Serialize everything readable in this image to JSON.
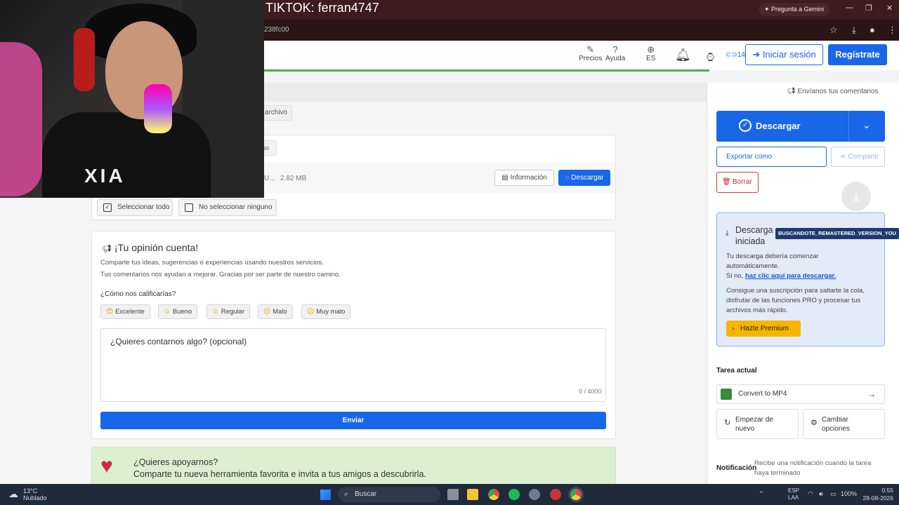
{
  "overlay": {
    "tiktok": "TIKTOK: ferran4747"
  },
  "browser": {
    "url_fragment": "238fc00",
    "gemini_button": "Pregunta a Gemini",
    "min": "—",
    "restore": "❐",
    "close": "✕"
  },
  "header": {
    "precios": "Precios",
    "ayuda": "Ayuda",
    "lang": "ES",
    "credits": "14",
    "login": "Iniciar sesión",
    "register": "Regístrate"
  },
  "subbar": {
    "feedback_link": "Envíanos tus comentarios"
  },
  "files": {
    "archivo_chip": "archivo",
    "no_chip": "no",
    "file_name_fragment": "U...",
    "file_size": "2.82 MB",
    "info_button": "Información",
    "download_button": "Descargar",
    "select_all": "Seleccionar todo",
    "select_none": "No seleccionar ninguno"
  },
  "feedback": {
    "title": "Tu opinión cuenta!",
    "title_prefix": "¡",
    "line1": "Comparte tus ideas, sugerencias o experiencias usando nuestros servicios.",
    "line2": "Tus comentarios nos ayudan a mejorar. Gracias por ser parte de nuestro camino.",
    "question": "¿Cómo nos calificarías?",
    "ratings": [
      "Excelente",
      "Bueno",
      "Regular",
      "Malo",
      "Muy malo"
    ],
    "textarea_placeholder": "¿Quieres contarnos algo? (opcional)",
    "counter": "0 / 4000",
    "send": "Enviar"
  },
  "support": {
    "title": "¿Quieres apoyarnos?",
    "text": "Comparte tu nueva herramienta favorita e invita a tus amigos a descubrirla."
  },
  "sidebar": {
    "download": "Descargar",
    "export": "Exportar como",
    "share": "Compartir",
    "delete": "Borrar",
    "dl_started_title": "Descarga iniciada",
    "tooltip": "BUSCANDOTE_REMASTERED_VERSION_YOU",
    "dl_line1": "Tu descarga debería comenzar",
    "dl_line2": "automáticamente.",
    "dl_line3_prefix": "Si no,",
    "dl_link": "haz clic aquí para descargar.",
    "promo1": "Consigue una suscripción para saltarte la cola,",
    "promo2": "disfrutar de las funciones PRO y procesar tus",
    "promo3": "archivos más rápido.",
    "premium": "Hazte Premium",
    "current_task_label": "Tarea actual",
    "current_task": "Convert to MP4",
    "restart": "Empezar de nuevo",
    "change": "Cambiar opciones",
    "notification_label": "Notificación",
    "notification_text": "Recibe una notificación cuando la tarea haya terminado"
  },
  "taskbar": {
    "temp": "13°C",
    "weather": "Nublado",
    "search": "Buscar",
    "lang1": "ESP",
    "lang2": "LAA",
    "battery": "100%",
    "time": "0:55",
    "date": "28-08-2026"
  },
  "colors": {
    "primary": "#1a66e8",
    "premium": "#f7b500",
    "danger": "#d23a3a",
    "support_bg": "#dcf0d1"
  }
}
